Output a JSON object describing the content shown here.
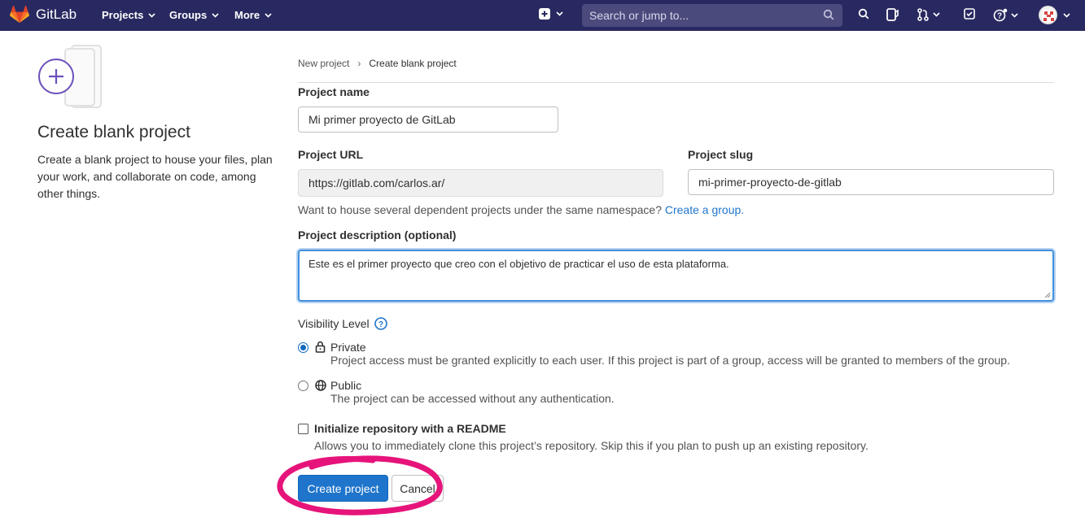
{
  "topbar": {
    "brand": "GitLab",
    "nav": [
      "Projects",
      "Groups",
      "More"
    ],
    "search_placeholder": "Search or jump to..."
  },
  "left": {
    "title": "Create blank project",
    "description": "Create a blank project to house your files, plan your work, and collaborate on code, among other things."
  },
  "breadcrumb": [
    "New project",
    "Create blank project"
  ],
  "form": {
    "project_name_label": "Project name",
    "project_name_value": "Mi primer proyecto de GitLab",
    "project_url_label": "Project URL",
    "project_url_value": "https://gitlab.com/carlos.ar/",
    "project_slug_label": "Project slug",
    "project_slug_value": "mi-primer-proyecto-de-gitlab",
    "namespace_help": "Want to house several dependent projects under the same namespace?",
    "namespace_link": "Create a group.",
    "description_label": "Project description (optional)",
    "description_value": "Este es el primer proyecto que creo con el objetivo de practicar el uso de esta plataforma.",
    "visibility_label": "Visibility Level",
    "visibility_options": [
      {
        "title": "Private",
        "desc": "Project access must be granted explicitly to each user. If this project is part of a group, access will be granted to members of the group.",
        "checked": true
      },
      {
        "title": "Public",
        "desc": "The project can be accessed without any authentication.",
        "checked": false
      }
    ],
    "readme_label": "Initialize repository with a README",
    "readme_desc": "Allows you to immediately clone this project’s repository. Skip this if you plan to push up an existing repository.",
    "create_button": "Create project",
    "cancel_button": "Cancel"
  },
  "colors": {
    "topbar": "#292961",
    "primary": "#1f75cb",
    "annotation": "#e6147a"
  }
}
